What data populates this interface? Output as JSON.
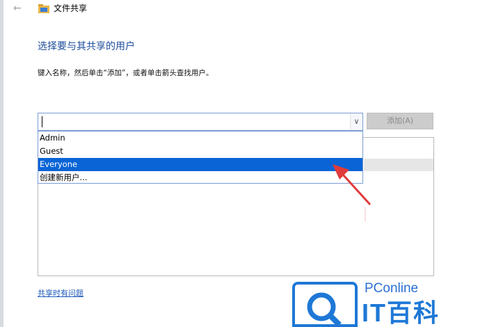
{
  "window": {
    "title": "文件共享",
    "icons": {
      "back": "back-arrow-icon",
      "app": "folder-share-icon"
    }
  },
  "main": {
    "heading": "选择要与其共享的用户",
    "instruction": "键入名称，然后单击“添加”，或者单击箭头查找用户。"
  },
  "combo": {
    "value": "",
    "dropdown_icon": "chevron-down-icon"
  },
  "add_button": {
    "label": "添加(A)",
    "enabled": false
  },
  "dropdown": {
    "items": [
      {
        "label": "Admin",
        "selected": false
      },
      {
        "label": "Guest",
        "selected": false
      },
      {
        "label": "Everyone",
        "selected": true
      },
      {
        "label": "创建新用户...",
        "selected": false
      }
    ]
  },
  "footer": {
    "trouble_link": "共享时有问题"
  },
  "watermark": {
    "brand": "PConline",
    "cn_text": "IT百科"
  },
  "colors": {
    "heading": "#1f4e9c",
    "selection": "#0a64d6",
    "annotation_arrow": "#e03a3a",
    "watermark": "#1e78d6"
  }
}
